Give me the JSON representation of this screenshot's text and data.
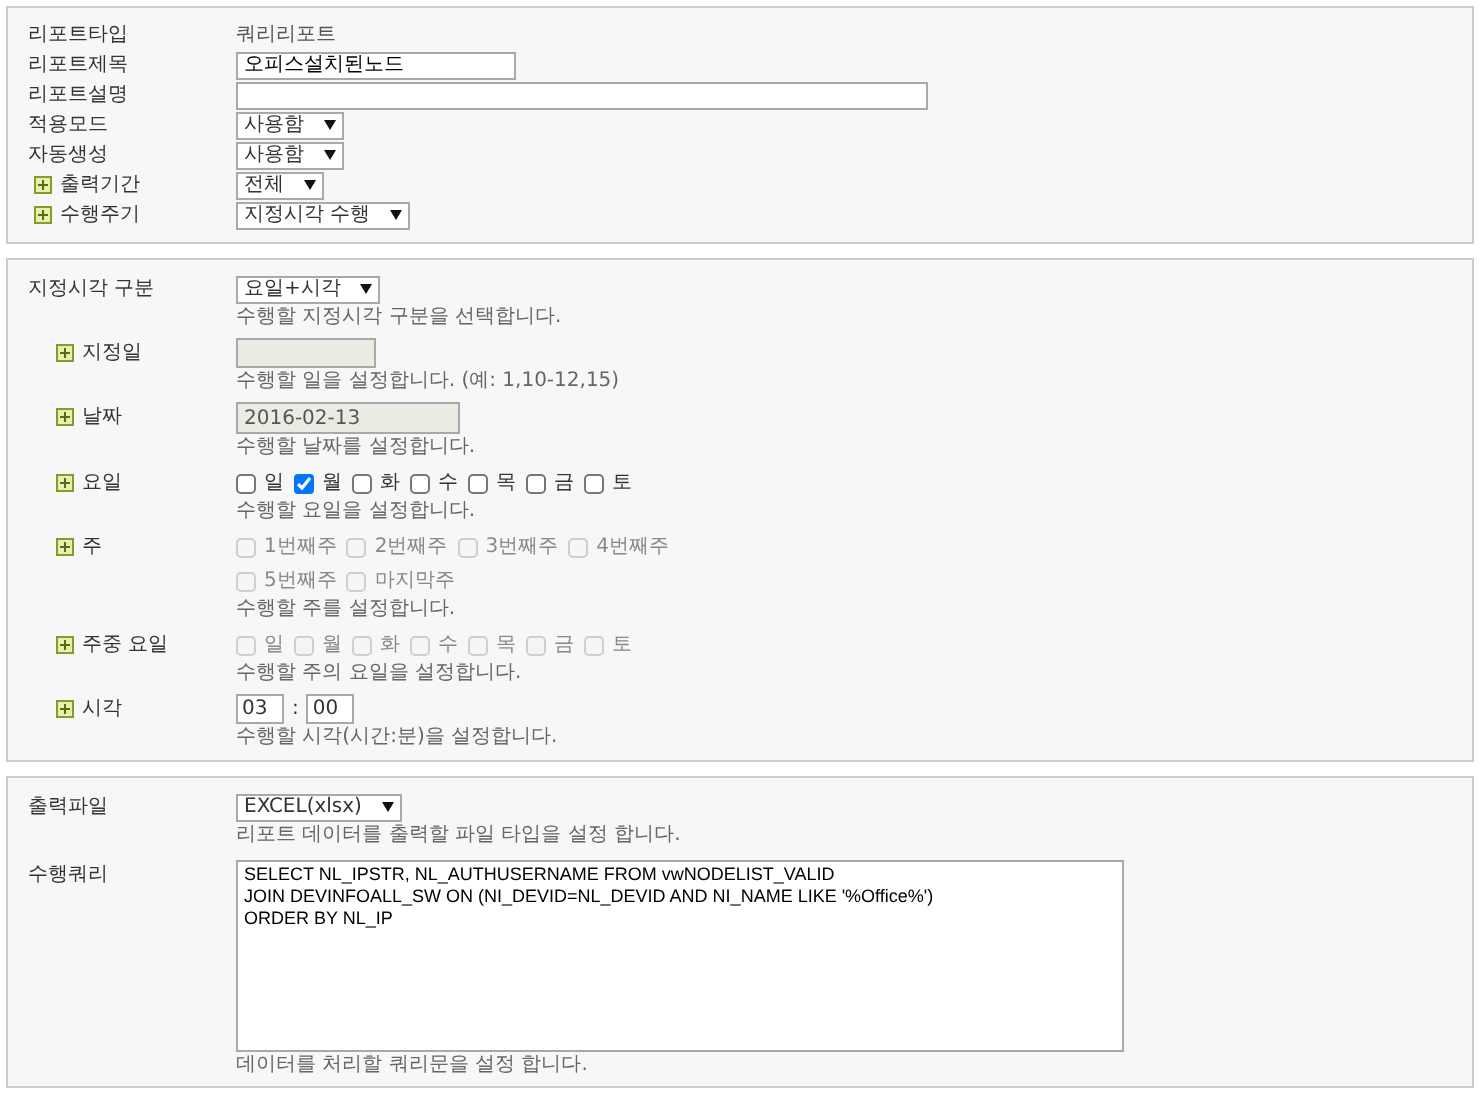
{
  "report": {
    "fields": [
      {
        "kind": "text",
        "label": "리포트타입",
        "expandable": false,
        "value": "쿼리리포트"
      },
      {
        "kind": "input",
        "label": "리포트제목",
        "expandable": false,
        "value": "오피스설치된노드"
      },
      {
        "kind": "wide-input",
        "label": "리포트설명",
        "expandable": false
      },
      {
        "kind": "select",
        "label": "적용모드",
        "expandable": false,
        "value": "사용함"
      },
      {
        "kind": "select",
        "label": "자동생성",
        "expandable": false,
        "value": "사용함"
      },
      {
        "kind": "select",
        "label": "출력기간",
        "expandable": true,
        "value": "전체"
      },
      {
        "kind": "select",
        "label": "수행주기",
        "expandable": true,
        "value": "지정시각 수행"
      }
    ]
  },
  "schedule": {
    "fields": [
      {
        "kind": "select",
        "label": "지정시각 구분",
        "expandable": false,
        "value": "요일+시각",
        "help": "수행할 지정시각 구분을 선택합니다."
      },
      {
        "kind": "day-input",
        "label": "지정일",
        "expandable": true,
        "disabled": true,
        "help": "수행할 일을 설정합니다. (예: 1,10-12,15)"
      },
      {
        "kind": "date-input",
        "label": "날짜",
        "expandable": true,
        "disabled": true,
        "value": "2016-02-13",
        "help": "수행할 날짜를 설정합니다."
      },
      {
        "kind": "checkboxes",
        "label": "요일",
        "expandable": true,
        "disabled": false,
        "options": [
          {
            "label": "일",
            "checked": false
          },
          {
            "label": "월",
            "checked": true
          },
          {
            "label": "화",
            "checked": false
          },
          {
            "label": "수",
            "checked": false
          },
          {
            "label": "목",
            "checked": false
          },
          {
            "label": "금",
            "checked": false
          },
          {
            "label": "토",
            "checked": false
          }
        ],
        "help": "수행할 요일을 설정합니다."
      },
      {
        "kind": "checkboxes",
        "label": "주",
        "expandable": true,
        "disabled": true,
        "options": [
          {
            "label": "1번째주",
            "checked": false
          },
          {
            "label": "2번째주",
            "checked": false
          },
          {
            "label": "3번째주",
            "checked": false
          },
          {
            "label": "4번째주",
            "checked": false
          },
          {
            "label": "5번째주",
            "checked": false
          },
          {
            "label": "마지막주",
            "checked": false
          }
        ],
        "help": "수행할 주를 설정합니다."
      },
      {
        "kind": "checkboxes",
        "label": "주중 요일",
        "expandable": true,
        "disabled": true,
        "options": [
          {
            "label": "일",
            "checked": false
          },
          {
            "label": "월",
            "checked": false
          },
          {
            "label": "화",
            "checked": false
          },
          {
            "label": "수",
            "checked": false
          },
          {
            "label": "목",
            "checked": false
          },
          {
            "label": "금",
            "checked": false
          },
          {
            "label": "토",
            "checked": false
          }
        ],
        "help": "수행할 주의 요일을 설정합니다."
      },
      {
        "kind": "time",
        "label": "시각",
        "expandable": true,
        "hour": "03",
        "separator": ":",
        "minute": "00",
        "help": "수행할 시각(시간:분)을 설정합니다."
      }
    ]
  },
  "output": {
    "fields": [
      {
        "kind": "select",
        "label": "출력파일",
        "expandable": false,
        "value": "EXCEL(xlsx)",
        "help": "리포트 데이터를 출력할 파일 타입을 설정 합니다."
      },
      {
        "kind": "textarea",
        "label": "수행쿼리",
        "expandable": false,
        "value": "SELECT NL_IPSTR, NL_AUTHUSERNAME FROM vwNODELIST_VALID\nJOIN DEVINFOALL_SW ON (NI_DEVID=NL_DEVID AND NI_NAME LIKE '%Office%')\nORDER BY NL_IP",
        "help": "데이터를 처리할 쿼리문을 설정 합니다."
      }
    ]
  }
}
